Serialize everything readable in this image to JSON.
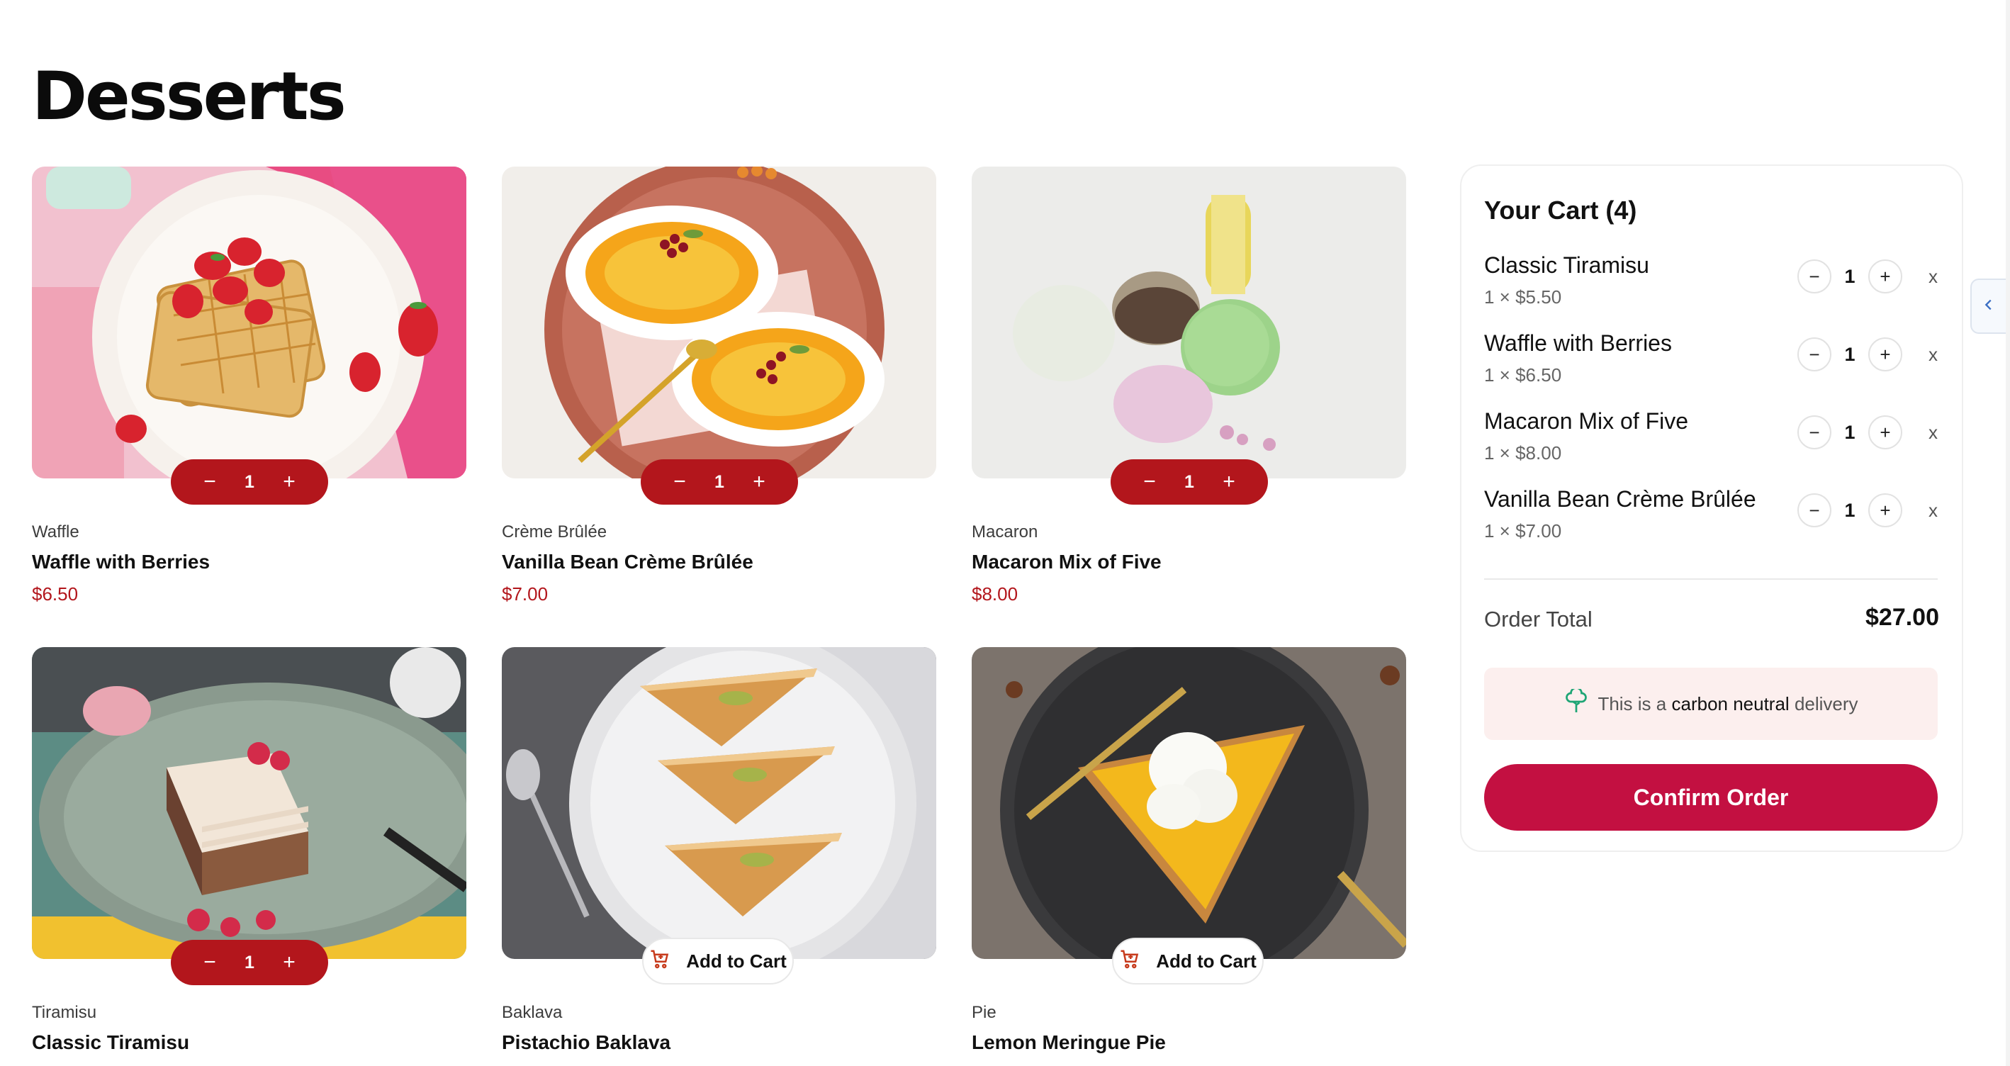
{
  "page": {
    "title": "Desserts"
  },
  "products": [
    {
      "category": "Waffle",
      "name": "Waffle with Berries",
      "price": "$6.50",
      "in_cart": true,
      "quantity": "1",
      "image": "waffle"
    },
    {
      "category": "Crème Brûlée",
      "name": "Vanilla Bean Crème Brûlée",
      "price": "$7.00",
      "in_cart": true,
      "quantity": "1",
      "image": "creme-brulee"
    },
    {
      "category": "Macaron",
      "name": "Macaron Mix of Five",
      "price": "$8.00",
      "in_cart": true,
      "quantity": "1",
      "image": "macaron"
    },
    {
      "category": "Tiramisu",
      "name": "Classic Tiramisu",
      "price": "",
      "in_cart": true,
      "quantity": "1",
      "image": "tiramisu"
    },
    {
      "category": "Baklava",
      "name": "Pistachio Baklava",
      "price": "",
      "in_cart": false,
      "add_label": "Add to Cart",
      "image": "baklava"
    },
    {
      "category": "Pie",
      "name": "Lemon Meringue Pie",
      "price": "",
      "in_cart": false,
      "add_label": "Add to Cart",
      "image": "pie"
    }
  ],
  "stepper": {
    "minus": "−",
    "plus": "+"
  },
  "cart": {
    "title": "Your Cart (4)",
    "items": [
      {
        "name": "Classic Tiramisu",
        "detail": "1 × $5.50",
        "quantity": "1"
      },
      {
        "name": "Waffle with Berries",
        "detail": "1 × $6.50",
        "quantity": "1"
      },
      {
        "name": "Macaron Mix of Five",
        "detail": "1 × $8.00",
        "quantity": "1"
      },
      {
        "name": "Vanilla Bean Crème Brûlée",
        "detail": "1 × $7.00",
        "quantity": "1"
      }
    ],
    "remove_label": "x",
    "total_label": "Order Total",
    "total_value": "$27.00",
    "carbon_prefix": "This is a",
    "carbon_bold": "carbon neutral",
    "carbon_suffix": "delivery",
    "confirm_label": "Confirm Order"
  },
  "colors": {
    "accent_red": "#b3161c",
    "confirm": "#c31041",
    "carbon_bg": "#fcefee",
    "tree_icon": "#1ea575"
  },
  "icons": {
    "add_to_cart": "cart-icon",
    "carbon": "tree-icon",
    "side_tab": "chevron-left-icon"
  }
}
